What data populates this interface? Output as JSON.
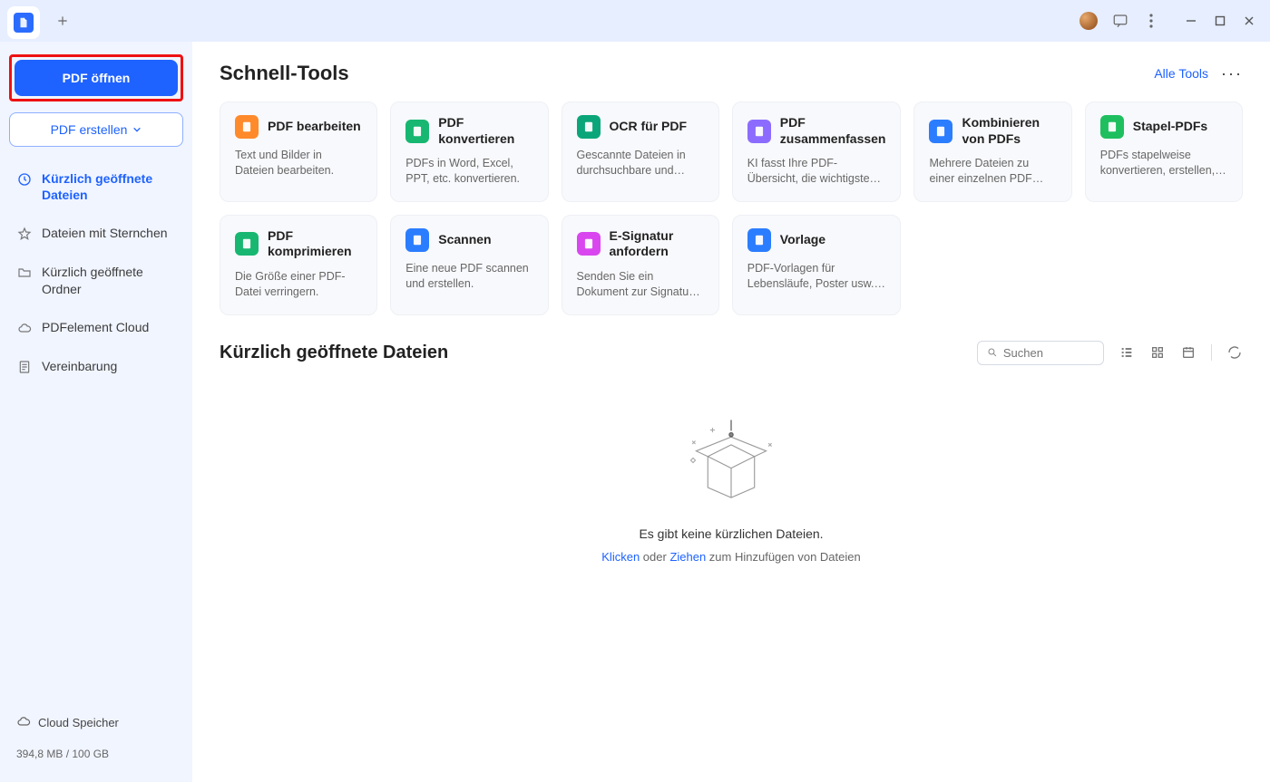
{
  "sidebar": {
    "open_btn": "PDF öffnen",
    "create_btn": "PDF erstellen",
    "nav": [
      {
        "label": "Kürzlich geöffnete Dateien"
      },
      {
        "label": "Dateien mit Sternchen"
      },
      {
        "label": "Kürzlich geöffnete Ordner"
      },
      {
        "label": "PDFelement Cloud"
      },
      {
        "label": "Vereinbarung"
      }
    ],
    "cloud_label": "Cloud Speicher",
    "storage": "394,8 MB / 100 GB"
  },
  "quick": {
    "title": "Schnell-Tools",
    "all": "Alle Tools",
    "cards": [
      {
        "title": "PDF bearbeiten",
        "desc": "Text und Bilder in Dateien bearbeiten.",
        "color": "#ff8a2b"
      },
      {
        "title": "PDF konvertieren",
        "desc": "PDFs in Word, Excel, PPT, etc. konvertieren.",
        "color": "#17b771"
      },
      {
        "title": "OCR für PDF",
        "desc": "Gescannte Dateien in durchsuchbare und bearbeit...",
        "color": "#0aa67a"
      },
      {
        "title": "PDF zusammenfassen",
        "desc": "KI fasst Ihre PDF-Übersicht, die wichtigsten Punkte usw...",
        "color": "#8c6cff"
      },
      {
        "title": "Kombinieren von PDFs",
        "desc": "Mehrere Dateien zu einer einzelnen PDF zusammenfü...",
        "color": "#2b7dff"
      },
      {
        "title": "Stapel-PDFs",
        "desc": "PDFs stapelweise konvertieren, erstellen, druc...",
        "color": "#1fbf5f"
      },
      {
        "title": "PDF komprimieren",
        "desc": "Die Größe einer PDF-Datei verringern.",
        "color": "#17b771"
      },
      {
        "title": "Scannen",
        "desc": "Eine neue PDF scannen und erstellen.",
        "color": "#2b7dff"
      },
      {
        "title": "E-Signatur anfordern",
        "desc": "Senden Sie ein Dokument zur Signatur an andere.",
        "color": "#d946ef"
      },
      {
        "title": "Vorlage",
        "desc": "PDF-Vorlagen für Lebensläufe, Poster usw. erh...",
        "color": "#2b7dff"
      }
    ]
  },
  "recent": {
    "title": "Kürzlich geöffnete Dateien",
    "search_placeholder": "Suchen",
    "empty_msg": "Es gibt keine kürzlichen Dateien.",
    "hint_click": "Klicken",
    "hint_mid": " oder ",
    "hint_drag": "Ziehen",
    "hint_end": " zum Hinzufügen von Dateien"
  }
}
